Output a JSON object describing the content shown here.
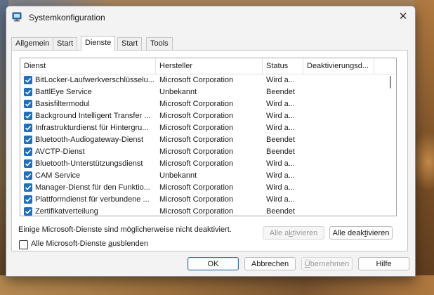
{
  "window": {
    "title": "Systemkonfiguration"
  },
  "tabs": [
    {
      "label": "Allgemein",
      "active": false
    },
    {
      "label": "Start",
      "active": false
    },
    {
      "label": "Dienste",
      "active": true
    },
    {
      "label": "Start",
      "active": false
    },
    {
      "label": "Tools",
      "active": false
    }
  ],
  "services_table": {
    "columns": [
      "Dienst",
      "Hersteller",
      "Status",
      "Deaktivierungsd..."
    ],
    "rows": [
      {
        "name": "BitLocker-Laufwerkverschlüsselu...",
        "manufacturer": "Microsoft Corporation",
        "status": "Wird a...",
        "checked": true
      },
      {
        "name": "BattlEye Service",
        "manufacturer": "Unbekannt",
        "status": "Beendet",
        "checked": true
      },
      {
        "name": "Basisfiltermodul",
        "manufacturer": "Microsoft Corporation",
        "status": "Wird a...",
        "checked": true
      },
      {
        "name": "Background Intelligent Transfer ...",
        "manufacturer": "Microsoft Corporation",
        "status": "Wird a...",
        "checked": true
      },
      {
        "name": "Infrastrukturdienst für Hintergru...",
        "manufacturer": "Microsoft Corporation",
        "status": "Wird a...",
        "checked": true
      },
      {
        "name": "Bluetooth-Audiogateway-Dienst",
        "manufacturer": "Microsoft Corporation",
        "status": "Beendet",
        "checked": true
      },
      {
        "name": "AVCTP-Dienst",
        "manufacturer": "Microsoft Corporation",
        "status": "Beendet",
        "checked": true
      },
      {
        "name": "Bluetooth-Unterstützungsdienst",
        "manufacturer": "Microsoft Corporation",
        "status": "Wird a...",
        "checked": true
      },
      {
        "name": "CAM Service",
        "manufacturer": "Unbekannt",
        "status": "Wird a...",
        "checked": true
      },
      {
        "name": "Manager-Dienst für den Funktio...",
        "manufacturer": "Microsoft Corporation",
        "status": "Wird a...",
        "checked": true
      },
      {
        "name": "Plattformdienst für verbundene ...",
        "manufacturer": "Microsoft Corporation",
        "status": "Wird a...",
        "checked": true
      },
      {
        "name": "Zertifikatverteilung",
        "manufacturer": "Microsoft Corporation",
        "status": "Beendet",
        "checked": true
      }
    ]
  },
  "info_text": "Einige Microsoft-Dienste sind möglicherweise nicht deaktiviert.",
  "enable_all": {
    "pre": "Alle a",
    "key": "k",
    "post": "tivieren"
  },
  "disable_all": {
    "pre": "Alle deak",
    "key": "t",
    "post": "ivieren"
  },
  "hide_ms": {
    "pre": "Alle Microsoft-Dienste ",
    "key": "a",
    "post": "usblenden",
    "checked": false
  },
  "buttons": {
    "ok": "OK",
    "cancel": "Abbrechen",
    "apply": {
      "key": "Ü",
      "post": "bernehmen"
    },
    "help": "Hilfe"
  },
  "colors": {
    "checkbox_blue": "#1a6fc9",
    "primary_border": "#2f6fb8"
  }
}
